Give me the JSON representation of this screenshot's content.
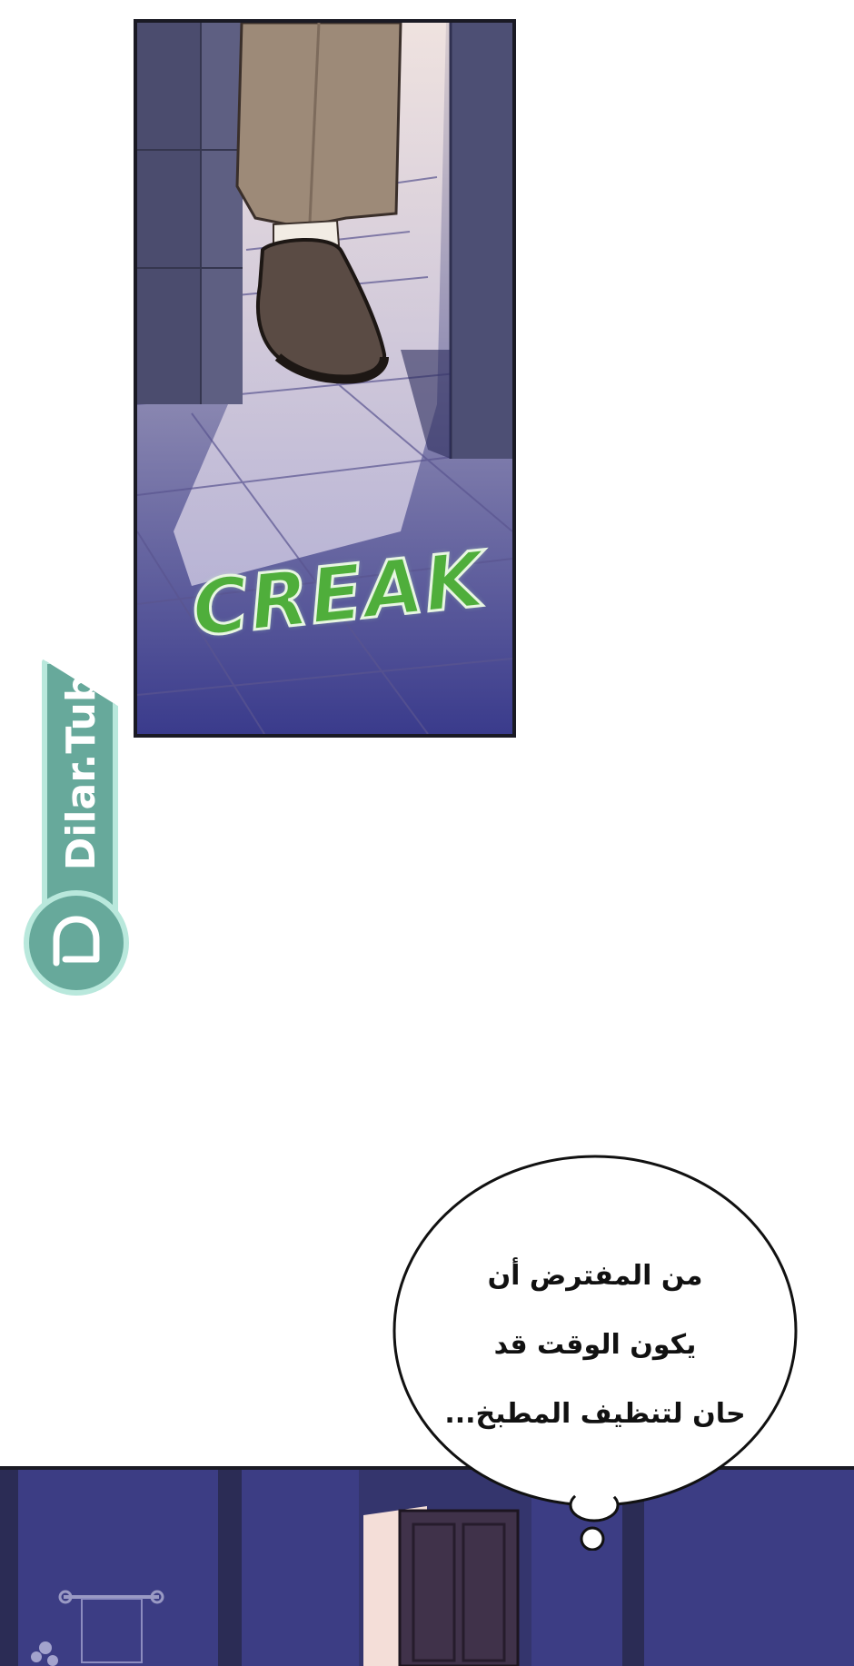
{
  "top_panel": {
    "sound_effect": "CREAK"
  },
  "watermark": {
    "text": "Dilar.Tube",
    "logo_icon": "dilar-logo-icon"
  },
  "speech_bubble": {
    "lines": [
      "من المفترض أن",
      "يكون الوقت قد",
      "حان لتنظيف المطبخ..."
    ]
  },
  "colors": {
    "sfx_green": "#4fae3b",
    "watermark_teal": "#67a99b",
    "watermark_border": "#b9e8dc",
    "night_purple": "#3c3d84"
  }
}
